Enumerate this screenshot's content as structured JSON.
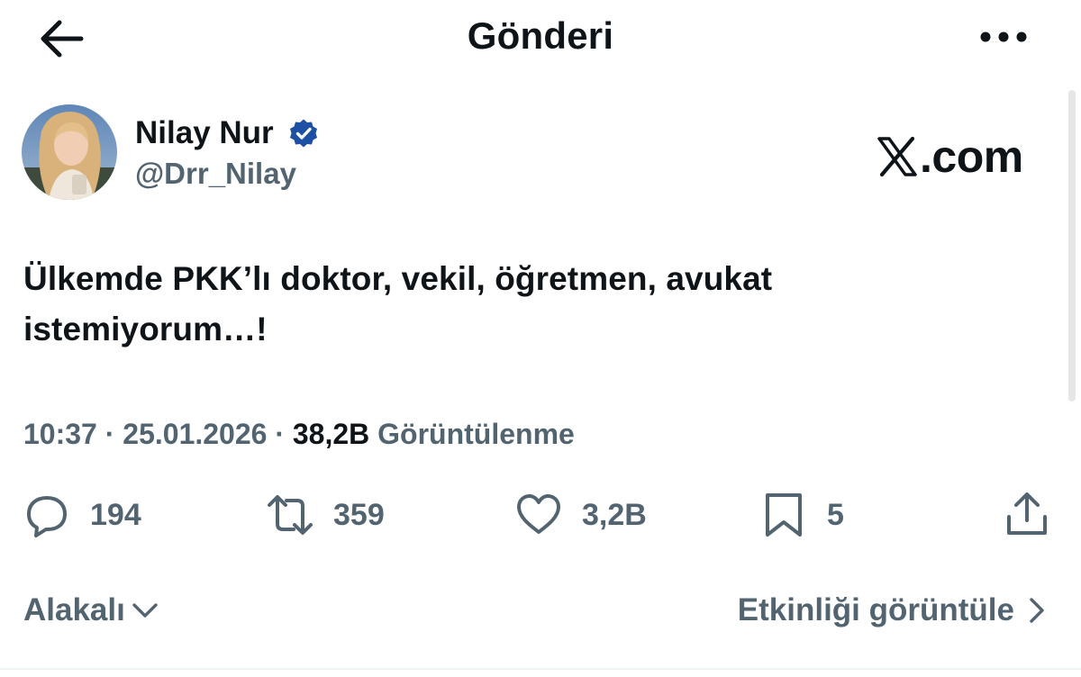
{
  "header": {
    "title": "Gönderi",
    "back_icon": "arrow-left-icon",
    "more_icon": "more-horizontal-icon"
  },
  "author": {
    "display_name": "Nilay Nur",
    "handle": "@Drr_Nilay",
    "verified": true,
    "verified_color": "#1d4fa3"
  },
  "watermark": {
    "text": ".com",
    "logo_icon": "x-logo-icon"
  },
  "tweet": {
    "text": "Ülkemde PKK’lı doktor, vekil, öğretmen, avukat istemiyorum…!"
  },
  "meta": {
    "time": "10:37",
    "separator": "·",
    "date": "25.01.2026",
    "views_count": "38,2B",
    "views_label": "Görüntülenme"
  },
  "actions": {
    "replies": "194",
    "reposts": "359",
    "likes": "3,2B",
    "bookmarks": "5"
  },
  "footer": {
    "relevance_label": "Alakalı",
    "activity_label": "Etkinliği görüntüle"
  },
  "colors": {
    "text_primary": "#0f1419",
    "text_secondary": "#536471",
    "background": "#ffffff"
  }
}
